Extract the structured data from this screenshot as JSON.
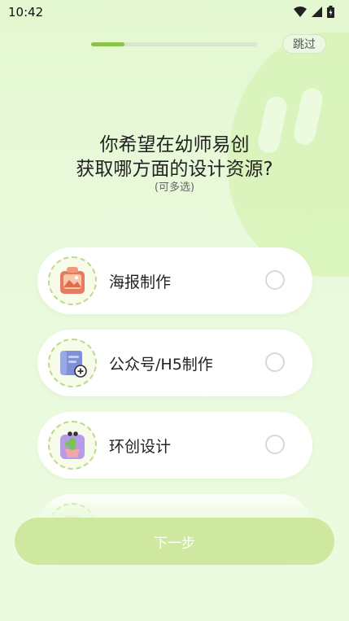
{
  "status_bar": {
    "time": "10:42"
  },
  "header": {
    "skip_label": "跳过",
    "progress": 0.2
  },
  "question": {
    "line1": "你希望在幼师易创",
    "line2": "获取哪方面的设计资源?",
    "hint": "(可多选)"
  },
  "options": [
    {
      "label": "海报制作",
      "icon": "poster-icon",
      "selected": false
    },
    {
      "label": "公众号/H5制作",
      "icon": "wechat-h5-icon",
      "selected": false
    },
    {
      "label": "环创设计",
      "icon": "cactus-pot-icon",
      "selected": false
    },
    {
      "label": "",
      "icon": "partial-icon",
      "selected": false
    }
  ],
  "footer": {
    "next_label": "下一步"
  },
  "colors": {
    "accent": "#8bc34a",
    "button": "#cfe8a0",
    "background": "#e6f8d5"
  }
}
